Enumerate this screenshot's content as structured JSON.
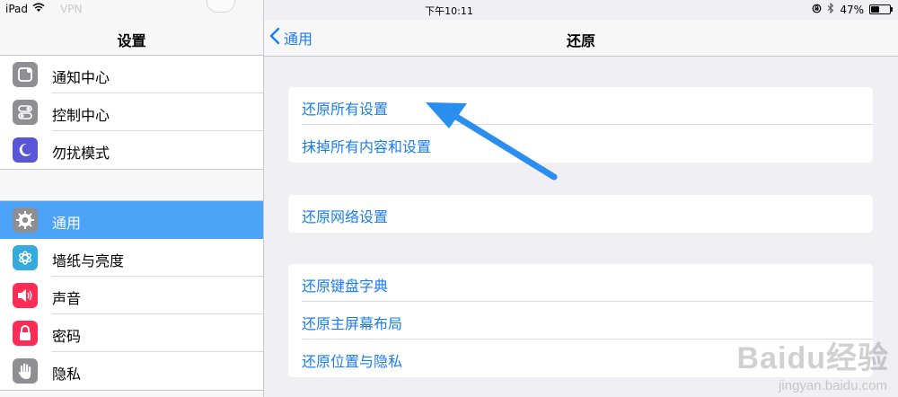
{
  "status_bar": {
    "device": "iPad",
    "vpn_ghost": "VPN",
    "time": "下午10:11",
    "battery": "47%",
    "battery_level": 0.47
  },
  "sidebar": {
    "title": "设置",
    "group1": [
      {
        "label": "通知中心",
        "icon": "notification-center-icon",
        "color": "#8e8e93"
      },
      {
        "label": "控制中心",
        "icon": "control-center-icon",
        "color": "#8e8e93"
      },
      {
        "label": "勿扰模式",
        "icon": "moon-icon",
        "color": "#5856d6"
      }
    ],
    "group2": [
      {
        "label": "通用",
        "icon": "gear-icon",
        "color": "#8e8e93",
        "selected": true
      },
      {
        "label": "墙纸与亮度",
        "icon": "wallpaper-icon",
        "color": "#35aadc"
      },
      {
        "label": "声音",
        "icon": "speaker-icon",
        "color": "#ff2d55"
      },
      {
        "label": "密码",
        "icon": "lock-icon",
        "color": "#ff2d55"
      },
      {
        "label": "隐私",
        "icon": "hand-icon",
        "color": "#8e8e93"
      }
    ]
  },
  "main": {
    "back_label": "通用",
    "title": "还原",
    "group1": [
      "还原所有设置",
      "抹掉所有内容和设置"
    ],
    "group2": [
      "还原网络设置"
    ],
    "group3": [
      "还原键盘字典",
      "还原主屏幕布局",
      "还原位置与隐私"
    ]
  },
  "colors": {
    "accent": "#1a7cf5",
    "selected_row": "#4da3f7",
    "arrow": "#2a8ef0"
  },
  "watermark": {
    "brand": "Baidu经验",
    "url": "jingyan.baidu.com"
  }
}
